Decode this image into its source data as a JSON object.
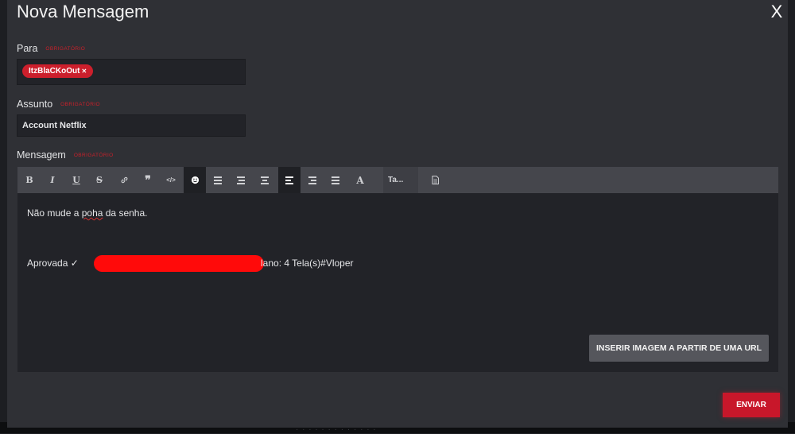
{
  "modal": {
    "title": "Nova Mensagem",
    "close_label": "X"
  },
  "recipient": {
    "label": "Para",
    "required": "Obrigatório",
    "tag": "ItzBlaCKoOut"
  },
  "subject": {
    "label": "Assunto",
    "required": "Obrigatório",
    "value": "Account Netflix"
  },
  "message": {
    "label": "Mensagem",
    "required": "Obrigatório",
    "line1_a": "Não mude a ",
    "line1_misspelled": "poha",
    "line1_b": " da senha.",
    "line2_prefix": "Aprovada ✓",
    "line2_suffix": "lano: 4 Tela(s)#Vloper"
  },
  "toolbar": {
    "bold": "B",
    "italic": "I",
    "underline": "U",
    "strike": "S",
    "link": "🔗",
    "quote": "❞",
    "code": "</>",
    "emoji": "☻",
    "text_color": "A",
    "font_size": "Ta...",
    "source": "🗎",
    "icons": [
      "bold-icon",
      "italic-icon",
      "underline-icon",
      "strikethrough-icon",
      "link-icon",
      "quote-icon",
      "code-icon",
      "emoji-icon",
      "bullet-list-icon",
      "numbered-list-icon",
      "align-center-icon",
      "align-left-icon",
      "align-right-icon",
      "justify-icon",
      "text-color-icon",
      "source-icon"
    ]
  },
  "buttons": {
    "insert_image_url": "INSERIR IMAGEM A PARTIR DE UMA URL",
    "send": "ENVIAR"
  },
  "colors": {
    "accent": "#c8172a",
    "modal_bg": "#2f3035",
    "field_bg": "#222328",
    "toolbar_bg": "#45464c",
    "redaction": "#ff0a0a"
  }
}
